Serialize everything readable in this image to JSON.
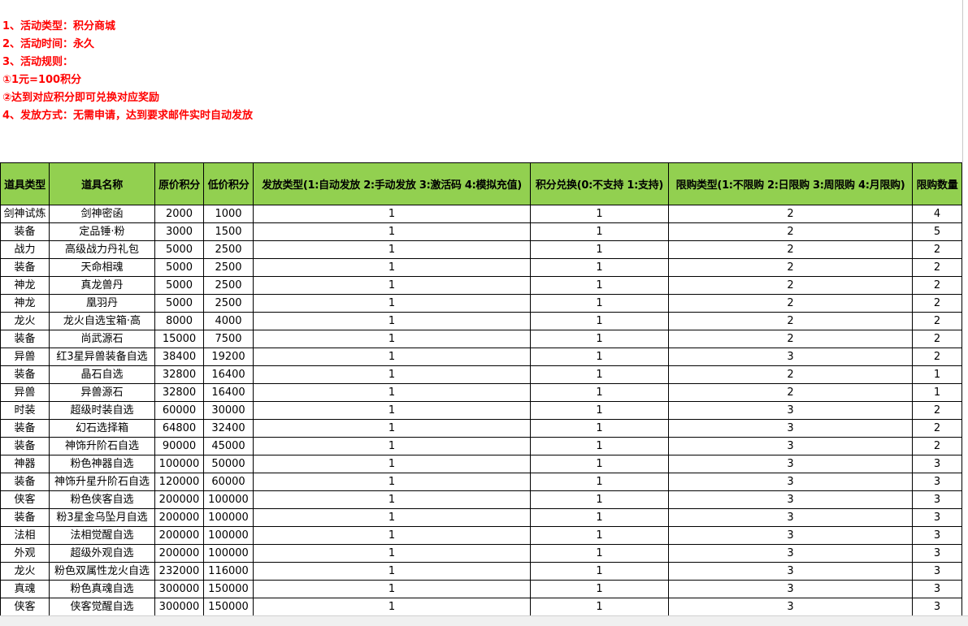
{
  "notes": [
    "1、活动类型：积分商城",
    "2、活动时间：永久",
    "3、活动规则：",
    "①1元=100积分",
    "②达到对应积分即可兑换对应奖励",
    "4、发放方式：无需申请，达到要求邮件实时自动发放"
  ],
  "headers": [
    "道具类型",
    "道具名称",
    "原价积分",
    "低价积分",
    "发放类型(1:自动发放 2:手动发放 3:激活码 4:模拟充值)",
    "积分兑换(0:不支持 1:支持)",
    "限购类型(1:不限购 2:日限购 3:周限购 4:月限购)",
    "限购数量"
  ],
  "rows": [
    [
      "剑神试炼",
      "剑神密函",
      "2000",
      "1000",
      "1",
      "1",
      "2",
      "4"
    ],
    [
      "装备",
      "定品锤·粉",
      "3000",
      "1500",
      "1",
      "1",
      "2",
      "5"
    ],
    [
      "战力",
      "高级战力丹礼包",
      "5000",
      "2500",
      "1",
      "1",
      "2",
      "2"
    ],
    [
      "装备",
      "天命相魂",
      "5000",
      "2500",
      "1",
      "1",
      "2",
      "2"
    ],
    [
      "神龙",
      "真龙兽丹",
      "5000",
      "2500",
      "1",
      "1",
      "2",
      "2"
    ],
    [
      "神龙",
      "凰羽丹",
      "5000",
      "2500",
      "1",
      "1",
      "2",
      "2"
    ],
    [
      "龙火",
      "龙火自选宝箱·高",
      "8000",
      "4000",
      "1",
      "1",
      "2",
      "2"
    ],
    [
      "装备",
      "尚武源石",
      "15000",
      "7500",
      "1",
      "1",
      "2",
      "2"
    ],
    [
      "异兽",
      "红3星异兽装备自选",
      "38400",
      "19200",
      "1",
      "1",
      "3",
      "2"
    ],
    [
      "装备",
      "晶石自选",
      "32800",
      "16400",
      "1",
      "1",
      "2",
      "1"
    ],
    [
      "异兽",
      "异兽源石",
      "32800",
      "16400",
      "1",
      "1",
      "2",
      "1"
    ],
    [
      "时装",
      "超级时装自选",
      "60000",
      "30000",
      "1",
      "1",
      "3",
      "2"
    ],
    [
      "装备",
      "幻石选择箱",
      "64800",
      "32400",
      "1",
      "1",
      "3",
      "2"
    ],
    [
      "装备",
      "神饰升阶石自选",
      "90000",
      "45000",
      "1",
      "1",
      "3",
      "2"
    ],
    [
      "神器",
      "粉色神器自选",
      "100000",
      "50000",
      "1",
      "1",
      "3",
      "3"
    ],
    [
      "装备",
      "神饰升星升阶石自选",
      "120000",
      "60000",
      "1",
      "1",
      "3",
      "3"
    ],
    [
      "侠客",
      "粉色侠客自选",
      "200000",
      "100000",
      "1",
      "1",
      "3",
      "3"
    ],
    [
      "装备",
      "粉3星金乌坠月自选",
      "200000",
      "100000",
      "1",
      "1",
      "3",
      "3"
    ],
    [
      "法相",
      "法相觉醒自选",
      "200000",
      "100000",
      "1",
      "1",
      "3",
      "3"
    ],
    [
      "外观",
      "超级外观自选",
      "200000",
      "100000",
      "1",
      "1",
      "3",
      "3"
    ],
    [
      "龙火",
      "粉色双属性龙火自选",
      "232000",
      "116000",
      "1",
      "1",
      "3",
      "3"
    ],
    [
      "真魂",
      "粉色真魂自选",
      "300000",
      "150000",
      "1",
      "1",
      "3",
      "3"
    ],
    [
      "侠客",
      "侠客觉醒自选",
      "300000",
      "150000",
      "1",
      "1",
      "3",
      "3"
    ]
  ]
}
